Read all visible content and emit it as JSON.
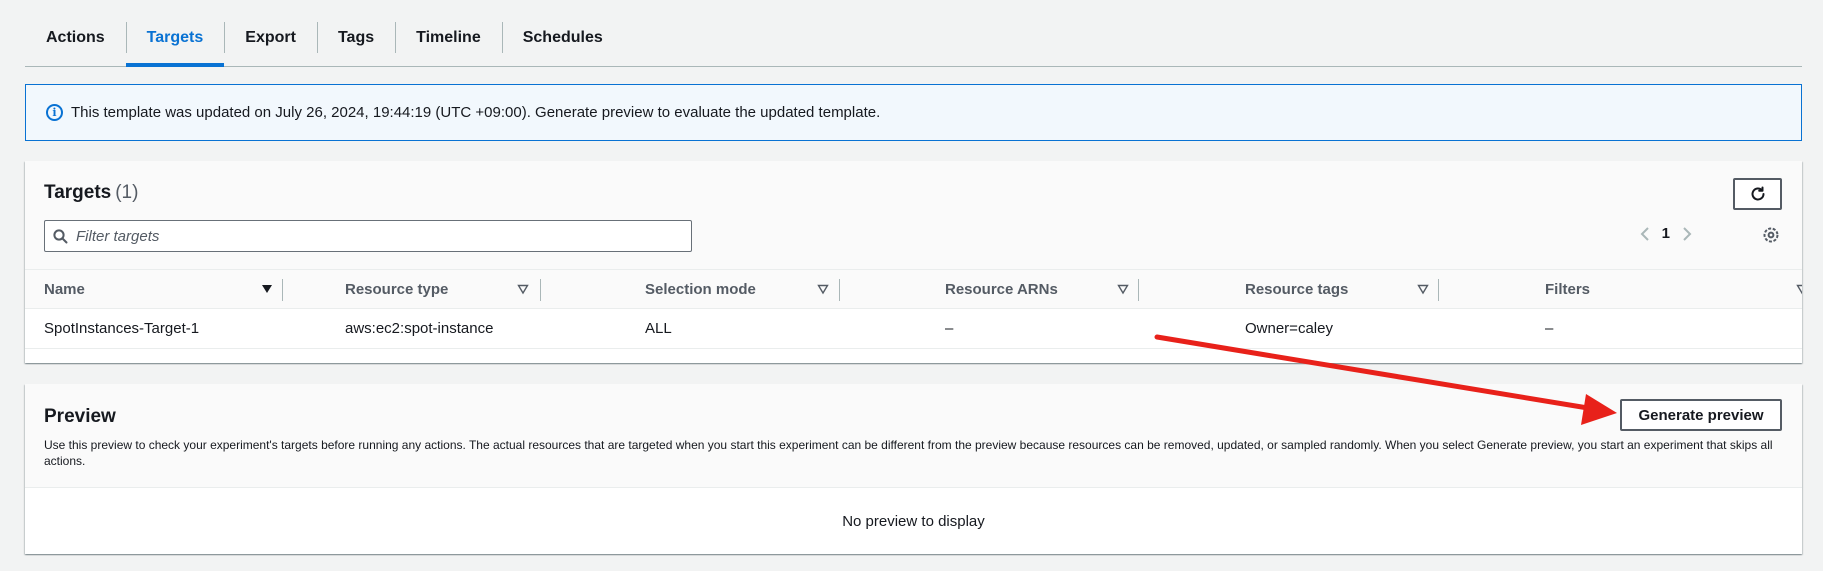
{
  "tabs": [
    {
      "label": "Actions"
    },
    {
      "label": "Targets"
    },
    {
      "label": "Export"
    },
    {
      "label": "Tags"
    },
    {
      "label": "Timeline"
    },
    {
      "label": "Schedules"
    }
  ],
  "active_tab": "Targets",
  "banner": {
    "icon": "info-icon",
    "message": "This template was updated on July 26, 2024, 19:44:19 (UTC +09:00). Generate preview to evaluate the updated template."
  },
  "targets": {
    "title": "Targets",
    "count": "(1)",
    "filter_placeholder": "Filter targets",
    "page_number": "1",
    "columns": [
      "Name",
      "Resource type",
      "Selection mode",
      "Resource ARNs",
      "Resource tags",
      "Filters"
    ],
    "rows": [
      {
        "name": "SpotInstances-Target-1",
        "resource_type": "aws:ec2:spot-instance",
        "selection_mode": "ALL",
        "resource_arns": "–",
        "resource_tags": "Owner=caley",
        "filters": "–"
      }
    ]
  },
  "preview": {
    "title": "Preview",
    "description": "Use this preview to check your experiment's targets before running any actions. The actual resources that are targeted when you start this experiment can be different from the preview because resources can be removed, updated, or sampled randomly. When you select Generate preview, you start an experiment that skips all actions.",
    "button_label": "Generate preview",
    "empty_message": "No preview to display"
  },
  "colors": {
    "accent": "#0972d3",
    "annotation_arrow": "#e8211a"
  }
}
